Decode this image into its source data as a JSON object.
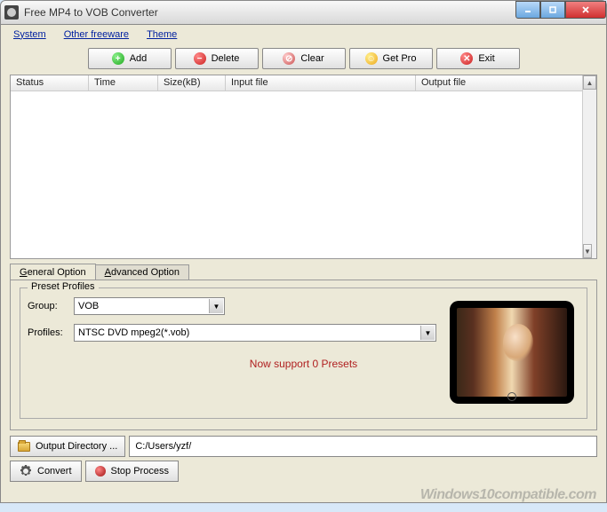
{
  "title": "Free MP4 to VOB Converter",
  "menu": {
    "system": "System",
    "other": "Other freeware",
    "theme": "Theme"
  },
  "toolbar": {
    "add": "Add",
    "delete": "Delete",
    "clear": "Clear",
    "getpro": "Get Pro",
    "exit": "Exit"
  },
  "columns": {
    "status": "Status",
    "time": "Time",
    "size": "Size(kB)",
    "input": "Input file",
    "output": "Output file"
  },
  "tabs": {
    "general": "General Option",
    "advanced": "Advanced Option"
  },
  "preset": {
    "legend": "Preset Profiles",
    "group_label": "Group:",
    "group_value": "VOB",
    "profiles_label": "Profiles:",
    "profiles_value": "NTSC DVD mpeg2(*.vob)",
    "status": "Now support 0 Presets"
  },
  "output": {
    "button": "Output Directory ...",
    "path": "C:/Users/yzf/"
  },
  "actions": {
    "convert": "Convert",
    "stop": "Stop Process"
  },
  "watermark": "Windows10compatible.com"
}
